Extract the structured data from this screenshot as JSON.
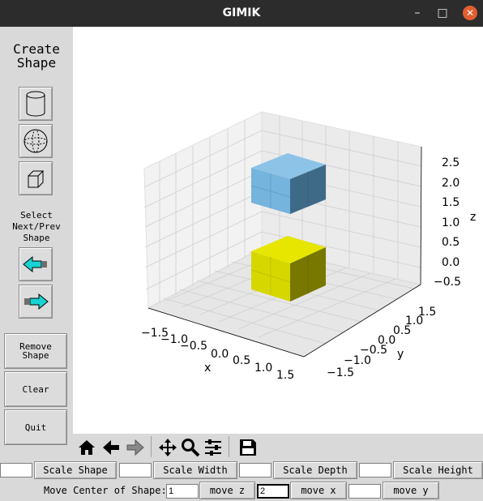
{
  "window": {
    "title": "GIMIK",
    "minimize_icon": "–",
    "maximize_icon": "□",
    "close_icon": "✕"
  },
  "sidebar": {
    "title_line1": "Create",
    "title_line2": "Shape",
    "shape_buttons": [
      "cylinder-icon",
      "sphere-icon",
      "cube-icon"
    ],
    "select_label_line1": "Select",
    "select_label_line2": "Next/Prev",
    "select_label_line3": "Shape",
    "prev_icon": "left-arrow-icon",
    "next_icon": "right-arrow-icon",
    "remove_line1": "Remove",
    "remove_line2": "Shape",
    "clear": "Clear",
    "quit": "Quit"
  },
  "plot": {
    "x_label": "x",
    "y_label": "y",
    "z_label": "z",
    "x_ticks": [
      "−1.5",
      "−1.0",
      "−0.5",
      "0.0",
      "0.5",
      "1.0",
      "1.5"
    ],
    "y_ticks": [
      "−1.5",
      "−1.0",
      "−0.5",
      "0.0",
      "0.5",
      "1.0",
      "1.5"
    ],
    "z_ticks": [
      "2.5",
      "2.0",
      "1.5",
      "1.0",
      "0.5",
      "0.0",
      "−0.5"
    ],
    "shapes": [
      {
        "type": "cube",
        "color": "#74b4dd",
        "center": [
          0,
          0,
          2
        ]
      },
      {
        "type": "cube",
        "color": "#d7d700",
        "center": [
          0,
          0,
          0
        ]
      }
    ],
    "colors": {
      "blue_top": "#8cc3e6",
      "blue_front": "#74b4dd",
      "blue_side": "#3e6a87",
      "yellow_top": "#e6e600",
      "yellow_front": "#d7d700",
      "yellow_side": "#787800"
    }
  },
  "toolbar": {
    "icons": [
      "home-icon",
      "back-icon",
      "forward-icon",
      "pan-icon",
      "zoom-icon",
      "configure-subplots-icon",
      "save-icon"
    ]
  },
  "controls": {
    "scale_shape": "Scale Shape",
    "scale_width": "Scale Width",
    "scale_depth": "Scale Depth",
    "scale_height": "Scale Height",
    "scale_shape_value": "",
    "scale_width_value": "",
    "scale_depth_value": "",
    "scale_height_value": "",
    "move_center_label": "Move Center of Shape:",
    "move_z": "move z",
    "move_x": "move x",
    "move_y": "move y",
    "move_z_value": "1",
    "move_x_value": "2",
    "move_y_value": ""
  }
}
